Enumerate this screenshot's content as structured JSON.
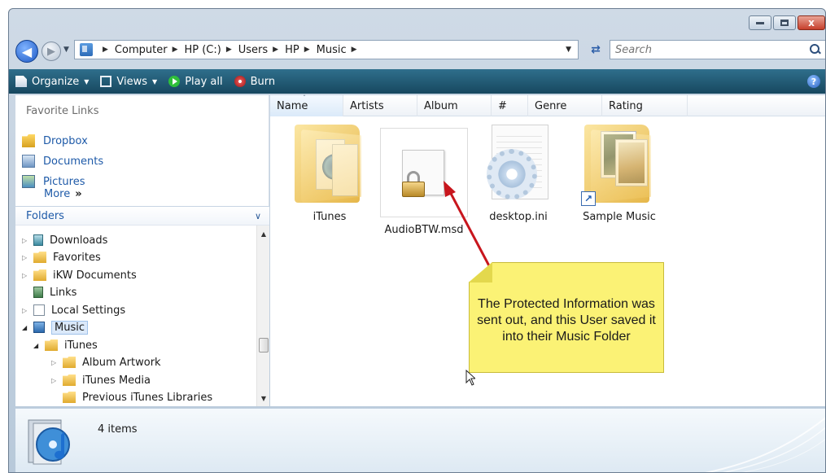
{
  "window": {
    "caption_buttons": [
      "minimize",
      "maximize",
      "close"
    ],
    "close_glyph": "x"
  },
  "address": {
    "back_glyph": "◀",
    "forward_glyph": "▶",
    "breadcrumbs": [
      "Computer",
      "HP (C:)",
      "Users",
      "HP",
      "Music"
    ],
    "refresh_glyph": "⇄",
    "search_placeholder": "Search"
  },
  "toolbar": {
    "items": [
      {
        "label": "Organize",
        "icon": "organize-icon",
        "has_caret": true
      },
      {
        "label": "Views",
        "icon": "views-icon",
        "has_caret": true
      },
      {
        "label": "Play all",
        "icon": "play-icon",
        "has_caret": false
      },
      {
        "label": "Burn",
        "icon": "burn-icon",
        "has_caret": false
      }
    ],
    "help_glyph": "?",
    "caret_glyph": "▼"
  },
  "favorites": {
    "title": "Favorite Links",
    "items": [
      {
        "label": "Dropbox",
        "icon": "dropbox-icon"
      },
      {
        "label": "Documents",
        "icon": "documents-icon"
      },
      {
        "label": "Pictures",
        "icon": "pictures-icon"
      }
    ],
    "more_label": "More",
    "more_glyph": "»"
  },
  "folders": {
    "title": "Folders",
    "chevron": "∨",
    "tree": [
      {
        "label": "Downloads",
        "expander": "▷"
      },
      {
        "label": "Favorites",
        "expander": "▷"
      },
      {
        "label": "iKW Documents",
        "expander": "▷"
      },
      {
        "label": "Links",
        "expander": ""
      },
      {
        "label": "Local Settings",
        "expander": "▷"
      },
      {
        "label": "Music",
        "expander": "◢"
      },
      {
        "label": "iTunes",
        "expander": "◢"
      },
      {
        "label": "Album Artwork",
        "expander": "▷"
      },
      {
        "label": "iTunes Media",
        "expander": "▷"
      },
      {
        "label": "Previous iTunes Libraries",
        "expander": ""
      }
    ],
    "scroll_up": "▲",
    "scroll_down": "▼"
  },
  "columns": [
    "Name",
    "Artists",
    "Album",
    "#",
    "Genre",
    "Rating"
  ],
  "sort_glyph": "ˆ",
  "files": [
    {
      "label": "iTunes",
      "icon": "folder-icon"
    },
    {
      "label": "AudioBTW.msd",
      "icon": "lock-icon"
    },
    {
      "label": "desktop.ini",
      "icon": "settings-file-icon"
    },
    {
      "label": "Sample Music",
      "icon": "folder-shortcut-icon"
    }
  ],
  "shortcut_glyph": "↗",
  "callout": {
    "text": "The Protected Information was sent out, and this User saved it into their Music Folder"
  },
  "details": {
    "count_text": "4 items"
  },
  "colors": {
    "toolbar": "#1f5570",
    "link": "#1e5aa8",
    "callout": "#fbf275",
    "arrow": "#c8161d"
  }
}
